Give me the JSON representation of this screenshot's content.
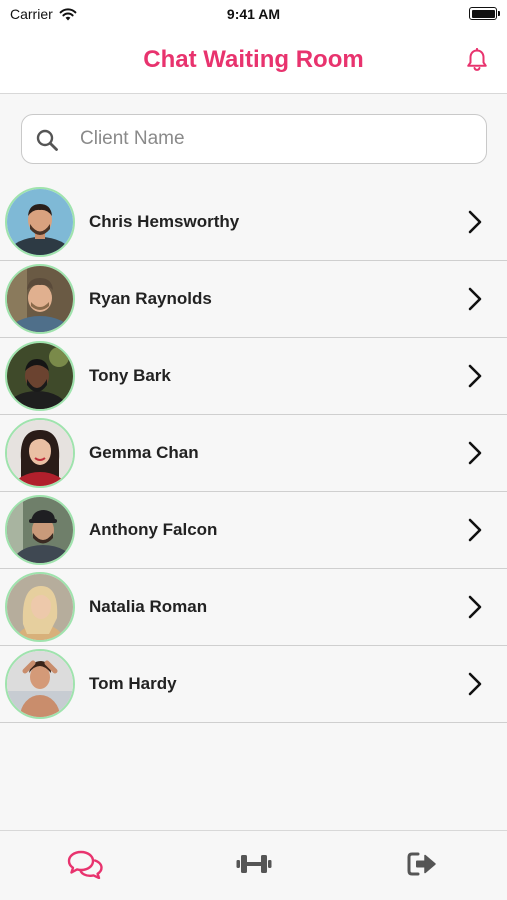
{
  "status_bar": {
    "carrier": "Carrier",
    "time": "9:41 AM"
  },
  "header": {
    "title": "Chat Waiting Room"
  },
  "search": {
    "placeholder": "Client Name",
    "value": ""
  },
  "clients": [
    {
      "name": "Chris Hemsworthy"
    },
    {
      "name": "Ryan Raynolds"
    },
    {
      "name": "Tony Bark"
    },
    {
      "name": "Gemma Chan"
    },
    {
      "name": "Anthony Falcon"
    },
    {
      "name": "Natalia Roman"
    },
    {
      "name": "Tom Hardy"
    }
  ],
  "tabs": [
    {
      "icon": "chat-bubbles-icon",
      "active": true
    },
    {
      "icon": "dumbbell-icon",
      "active": false
    },
    {
      "icon": "logout-icon",
      "active": false
    }
  ],
  "colors": {
    "accent": "#e8336e",
    "avatar_ring": "#9fe3ad",
    "inactive_icon": "#555555"
  }
}
